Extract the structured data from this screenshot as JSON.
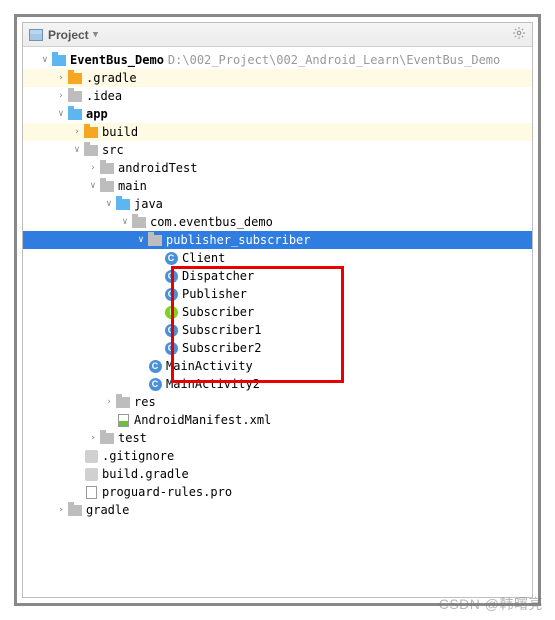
{
  "header": {
    "title": "Project"
  },
  "tree": {
    "root": {
      "name": "EventBus_Demo",
      "path": "D:\\002_Project\\002_Android_Learn\\EventBus_Demo"
    },
    "gradleDir": ".gradle",
    "ideaDir": ".idea",
    "app": "app",
    "build": "build",
    "src": "src",
    "androidTest": "androidTest",
    "main": "main",
    "java": "java",
    "pkg": "com.eventbus_demo",
    "pubsub": "publisher_subscriber",
    "classes": {
      "client": "Client",
      "dispatcher": "Dispatcher",
      "publisher": "Publisher",
      "subscriber": "Subscriber",
      "subscriber1": "Subscriber1",
      "subscriber2": "Subscriber2"
    },
    "mainActivity": "MainActivity",
    "mainActivity2": "MainActivity2",
    "res": "res",
    "manifest": "AndroidManifest.xml",
    "test": "test",
    "gitignore": ".gitignore",
    "buildGradle": "build.gradle",
    "proguard": "proguard-rules.pro",
    "gradleMod": "gradle"
  },
  "watermark": "CSDN @韩曙亮"
}
